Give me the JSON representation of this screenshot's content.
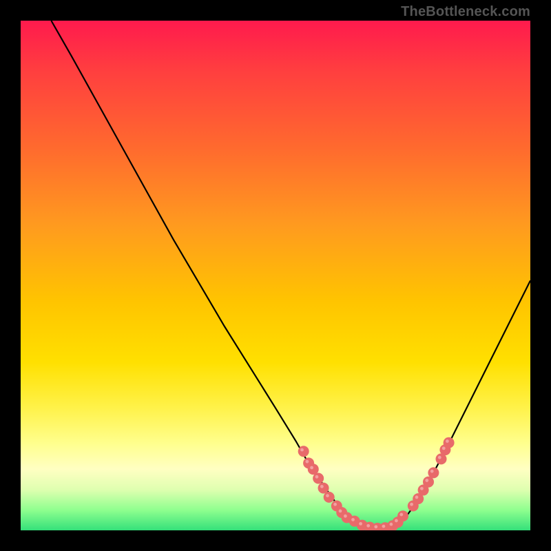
{
  "watermark": {
    "text": "TheBottleneck.com"
  },
  "colors": {
    "page_background": "#000000",
    "curve_stroke": "#000000",
    "dot_fill": "#E86A6A",
    "watermark_text": "#555555",
    "gradient_top": "#FF1A4D",
    "gradient_bottom": "#34E07A"
  },
  "chart_data": {
    "type": "line",
    "title": "",
    "xlabel": "",
    "ylabel": "",
    "xlim": [
      0,
      100
    ],
    "ylim": [
      0,
      100
    ],
    "grid": false,
    "series": [
      {
        "name": "curve",
        "x": [
          6,
          10,
          15,
          20,
          25,
          30,
          35,
          40,
          45,
          50,
          54,
          56,
          58,
          60,
          62,
          64,
          66,
          68,
          70,
          72,
          74,
          76,
          78,
          80,
          84,
          88,
          92,
          96,
          100
        ],
        "y": [
          100,
          93,
          84,
          75,
          66,
          57,
          48.5,
          40,
          32,
          24,
          17.5,
          14,
          11,
          8,
          5.2,
          3,
          1.5,
          0.7,
          0.4,
          0.6,
          1.4,
          3.2,
          6,
          9.4,
          17,
          25,
          33,
          41,
          49
        ]
      }
    ],
    "dots": [
      {
        "x": 55.5,
        "y": 15.5
      },
      {
        "x": 56.5,
        "y": 13.2
      },
      {
        "x": 57.4,
        "y": 12.0
      },
      {
        "x": 58.4,
        "y": 10.2
      },
      {
        "x": 59.4,
        "y": 8.3
      },
      {
        "x": 60.5,
        "y": 6.5
      },
      {
        "x": 62.0,
        "y": 4.8
      },
      {
        "x": 63.0,
        "y": 3.5
      },
      {
        "x": 64.0,
        "y": 2.5
      },
      {
        "x": 65.5,
        "y": 1.8
      },
      {
        "x": 67.0,
        "y": 1.0
      },
      {
        "x": 68.5,
        "y": 0.6
      },
      {
        "x": 70.0,
        "y": 0.4
      },
      {
        "x": 71.5,
        "y": 0.5
      },
      {
        "x": 73.0,
        "y": 0.9
      },
      {
        "x": 74.0,
        "y": 1.6
      },
      {
        "x": 75.0,
        "y": 2.8
      },
      {
        "x": 77.0,
        "y": 4.8
      },
      {
        "x": 78.0,
        "y": 6.2
      },
      {
        "x": 79.0,
        "y": 7.9
      },
      {
        "x": 80.0,
        "y": 9.5
      },
      {
        "x": 81.0,
        "y": 11.3
      },
      {
        "x": 82.5,
        "y": 14.0
      },
      {
        "x": 83.3,
        "y": 15.8
      },
      {
        "x": 84.0,
        "y": 17.2
      }
    ]
  }
}
